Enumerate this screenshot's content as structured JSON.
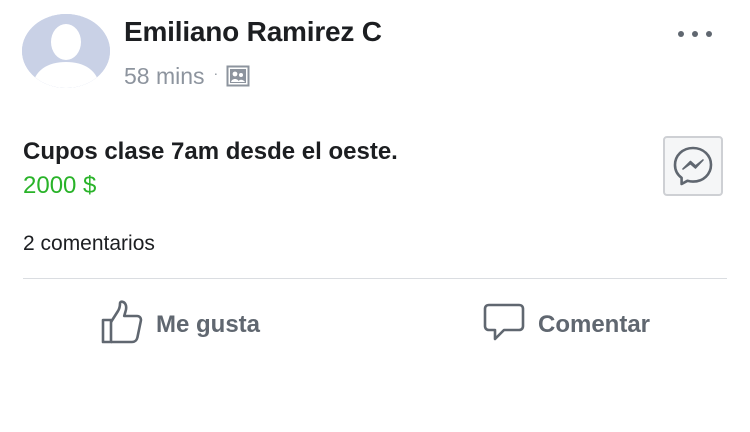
{
  "post": {
    "author_name": "Emiliano Ramirez C",
    "timestamp": "58 mins",
    "separator": "·",
    "audience_icon": "photo-album-icon",
    "title": "Cupos clase 7am desde el oeste.",
    "price": "2000 $",
    "comments_count": "2 comentarios"
  },
  "actions": {
    "like_label": "Me gusta",
    "comment_label": "Comentar"
  },
  "icons": {
    "more": "more-horizontal-icon",
    "messenger": "messenger-icon",
    "like": "thumbs-up-icon",
    "comment": "speech-bubble-icon"
  },
  "colors": {
    "price": "#29b329",
    "name": "#1c1e21",
    "meta": "#8d949e",
    "action": "#606770",
    "avatar_bg": "#c9d1e6"
  }
}
